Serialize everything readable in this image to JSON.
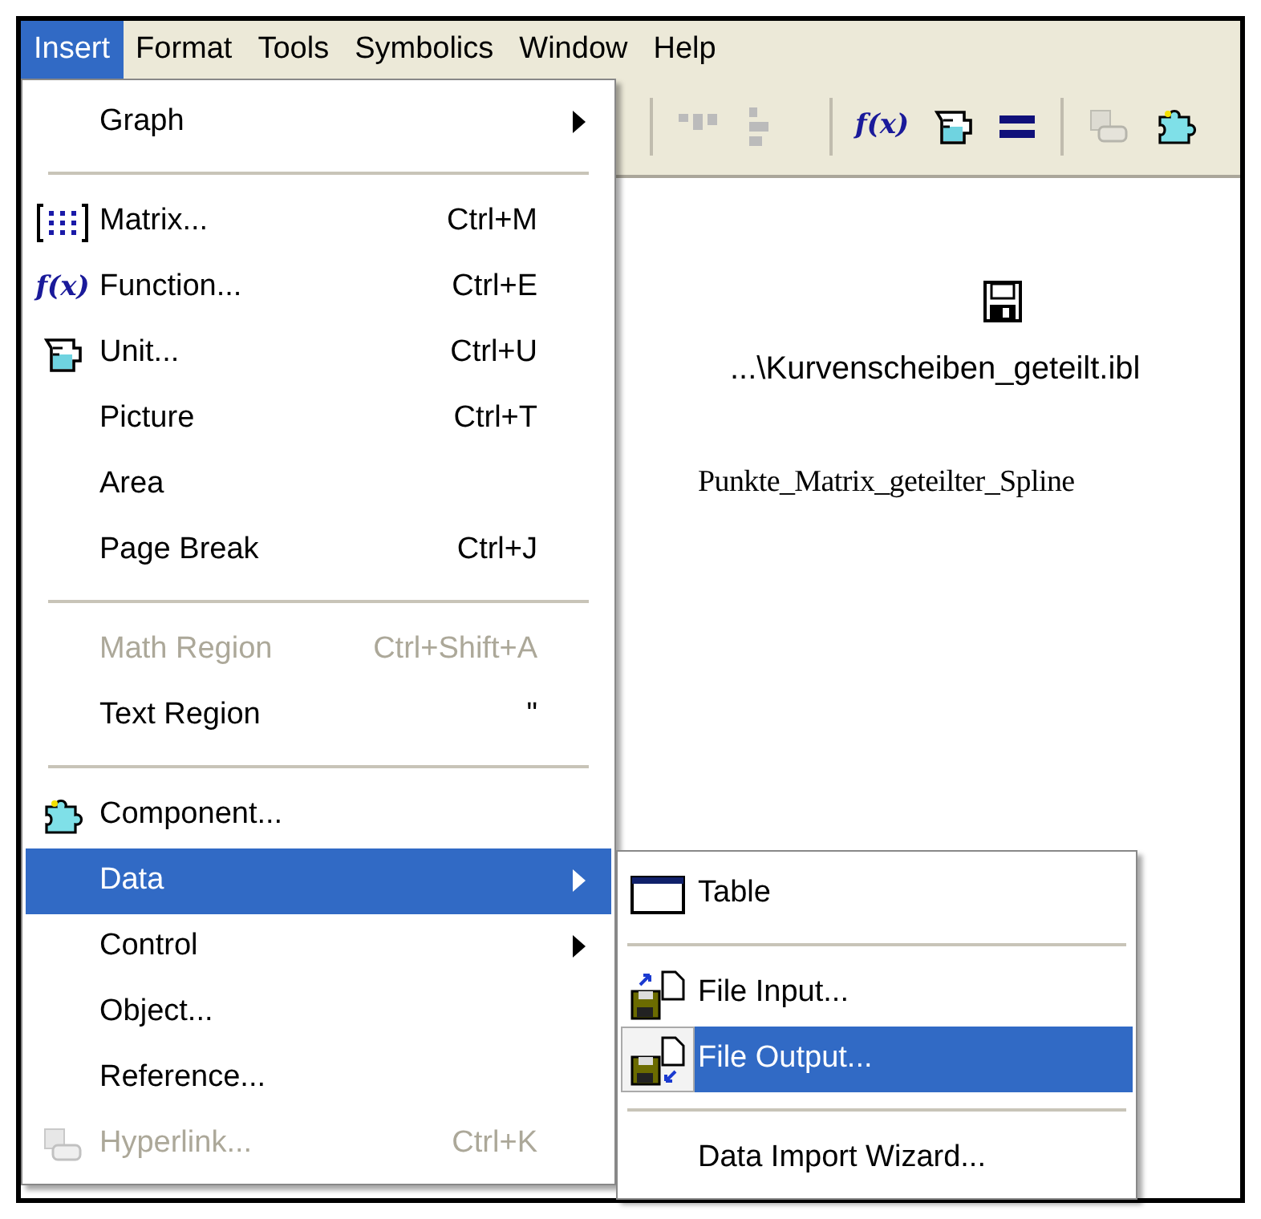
{
  "menubar": [
    {
      "label": "Insert",
      "selected": true
    },
    {
      "label": "Format",
      "selected": false
    },
    {
      "label": "Tools",
      "selected": false
    },
    {
      "label": "Symbolics",
      "selected": false
    },
    {
      "label": "Window",
      "selected": false
    },
    {
      "label": "Help",
      "selected": false
    }
  ],
  "toolbar": {
    "function_label": "f(x)"
  },
  "document": {
    "file_path": "...\\Kurvenscheiben_geteilt.ibl",
    "variable_name": "Punkte_Matrix_geteilter_Spline"
  },
  "insert_menu": [
    {
      "kind": "plain",
      "label": "Graph",
      "submenu": true,
      "disabled": false,
      "selected": false
    },
    {
      "kind": "separator"
    },
    {
      "kind": "matrix",
      "label": "Matrix...",
      "shortcut": "Ctrl+M",
      "disabled": false,
      "selected": false
    },
    {
      "kind": "function",
      "icon_text": "f(x)",
      "label": "Function...",
      "shortcut": "Ctrl+E",
      "disabled": false,
      "selected": false
    },
    {
      "kind": "unit",
      "label": "Unit...",
      "shortcut": "Ctrl+U",
      "disabled": false,
      "selected": false
    },
    {
      "kind": "plain",
      "label": "Picture",
      "shortcut": "Ctrl+T",
      "disabled": false,
      "selected": false
    },
    {
      "kind": "plain",
      "label": "Area",
      "disabled": false,
      "selected": false
    },
    {
      "kind": "plain",
      "label": "Page Break",
      "shortcut": "Ctrl+J",
      "disabled": false,
      "selected": false
    },
    {
      "kind": "separator"
    },
    {
      "kind": "plain",
      "label": "Math Region",
      "shortcut": "Ctrl+Shift+A",
      "disabled": true,
      "selected": false
    },
    {
      "kind": "plain",
      "label": "Text Region",
      "shortcut": "\"",
      "disabled": false,
      "selected": false
    },
    {
      "kind": "separator"
    },
    {
      "kind": "component",
      "label": "Component...",
      "disabled": false,
      "selected": false
    },
    {
      "kind": "plain",
      "label": "Data",
      "submenu": true,
      "disabled": false,
      "selected": true
    },
    {
      "kind": "plain",
      "label": "Control",
      "submenu": true,
      "disabled": false,
      "selected": false
    },
    {
      "kind": "plain",
      "label": "Object...",
      "disabled": false,
      "selected": false
    },
    {
      "kind": "plain",
      "label": "Reference...",
      "disabled": false,
      "selected": false
    },
    {
      "kind": "hyperlink",
      "label": "Hyperlink...",
      "shortcut": "Ctrl+K",
      "disabled": true,
      "selected": false
    }
  ],
  "data_submenu": [
    {
      "kind": "table",
      "label": "Table",
      "selected": false
    },
    {
      "kind": "separator"
    },
    {
      "kind": "fileinput",
      "label": "File Input...",
      "selected": false
    },
    {
      "kind": "fileoutput",
      "label": "File Output...",
      "selected": true
    },
    {
      "kind": "separator"
    },
    {
      "kind": "plain",
      "label": "Data Import Wizard...",
      "selected": false
    }
  ]
}
